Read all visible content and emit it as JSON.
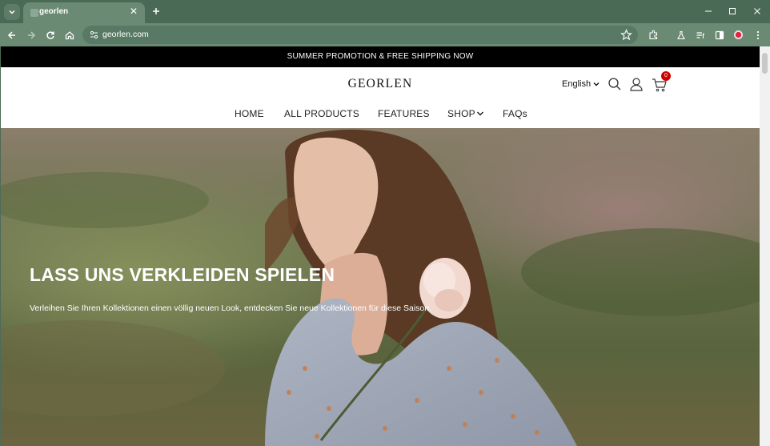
{
  "browser": {
    "tab_title": "georlen",
    "url": "georlen.com"
  },
  "promo": {
    "text": "SUMMER PROMOTION & FREE SHIPPING NOW"
  },
  "header": {
    "logo": "GEORLEN",
    "language": "English",
    "cart_count": "0"
  },
  "nav": {
    "items": [
      {
        "label": "HOME"
      },
      {
        "label": "ALL PRODUCTS"
      },
      {
        "label": "FEATURES"
      },
      {
        "label": "SHOP"
      },
      {
        "label": "FAQs"
      }
    ]
  },
  "hero": {
    "title": "LASS UNS VERKLEIDEN SPIELEN",
    "subtitle": "Verleihen Sie Ihren Kollektionen einen völlig neuen Look, entdecken Sie neue Kollektionen für diese Saison."
  }
}
